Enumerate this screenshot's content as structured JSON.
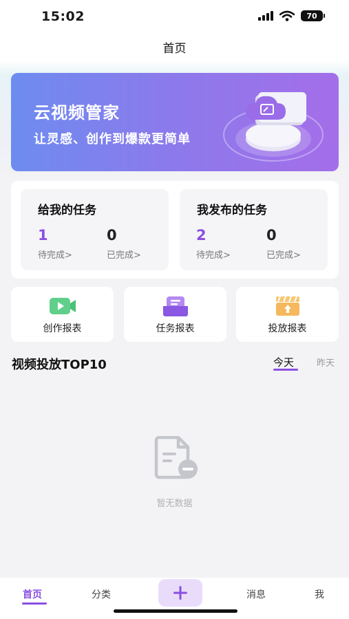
{
  "status_bar": {
    "time": "15:02",
    "battery": "70"
  },
  "nav": {
    "title": "首页"
  },
  "banner": {
    "title": "云视频管家",
    "subtitle": "让灵感、创作到爆款更简单"
  },
  "tasks": {
    "assigned_to_me": {
      "title": "给我的任务",
      "pending_count": "1",
      "pending_label": "待完成>",
      "done_count": "0",
      "done_label": "已完成>"
    },
    "published_by_me": {
      "title": "我发布的任务",
      "pending_count": "2",
      "pending_label": "待完成>",
      "done_count": "0",
      "done_label": "已完成>"
    }
  },
  "quick_links": [
    {
      "label": "创作报表",
      "icon": "video-camera-icon",
      "color": "#5fcf8a"
    },
    {
      "label": "任务报表",
      "icon": "message-tray-icon",
      "color": "#9a6ce8"
    },
    {
      "label": "投放报表",
      "icon": "clapperboard-upload-icon",
      "color": "#f5b85c"
    }
  ],
  "top10": {
    "title": "视频投放TOP10",
    "tabs": [
      "今天",
      "昨天"
    ],
    "active_tab": "今天",
    "empty_text": "暂无数据"
  },
  "tab_bar": {
    "items": [
      "首页",
      "分类",
      "消息",
      "我"
    ],
    "active": "首页",
    "plus": "+"
  },
  "colors": {
    "accent": "#8a4fe0",
    "banner_start": "#6d8cf0",
    "banner_end": "#a46ee9"
  }
}
